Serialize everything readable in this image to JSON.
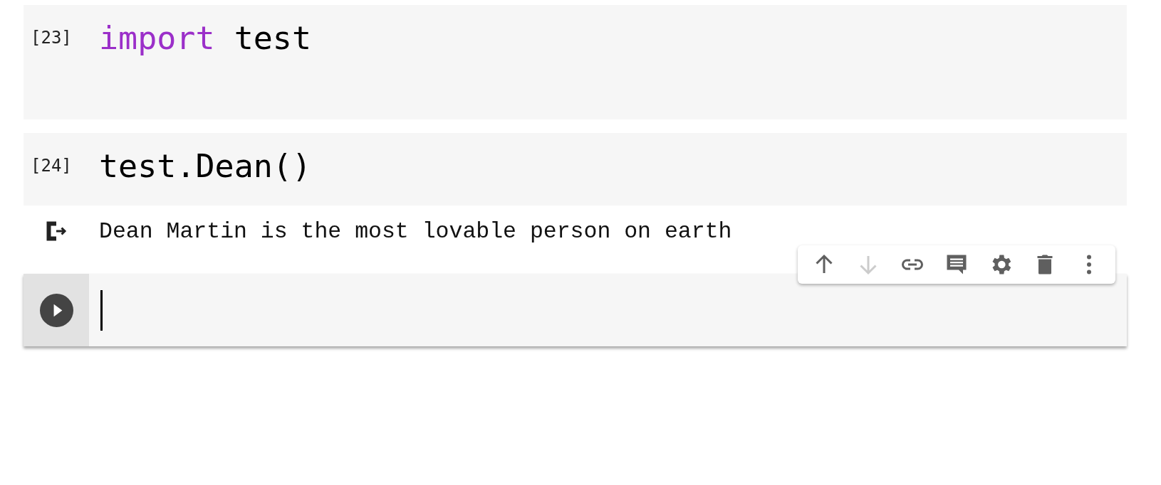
{
  "cells": [
    {
      "kind": "code",
      "execution_count": "[23]",
      "tall": true,
      "tokens": [
        {
          "text": "import",
          "keyword": true
        },
        {
          "text": " test",
          "keyword": false
        }
      ]
    },
    {
      "kind": "code",
      "execution_count": "[24]",
      "tall": false,
      "tokens": [
        {
          "text": "test.Dean()",
          "keyword": false
        }
      ]
    },
    {
      "kind": "output",
      "text": "Dean Martin is the most lovable person on earth"
    },
    {
      "kind": "active"
    }
  ],
  "cell_toolbar": [
    {
      "kind": "up",
      "disabled": false
    },
    {
      "kind": "down",
      "disabled": true
    },
    {
      "kind": "link",
      "disabled": false
    },
    {
      "kind": "comment",
      "disabled": false
    },
    {
      "kind": "settings",
      "disabled": false
    },
    {
      "kind": "delete",
      "disabled": false
    },
    {
      "kind": "more",
      "disabled": false
    }
  ]
}
